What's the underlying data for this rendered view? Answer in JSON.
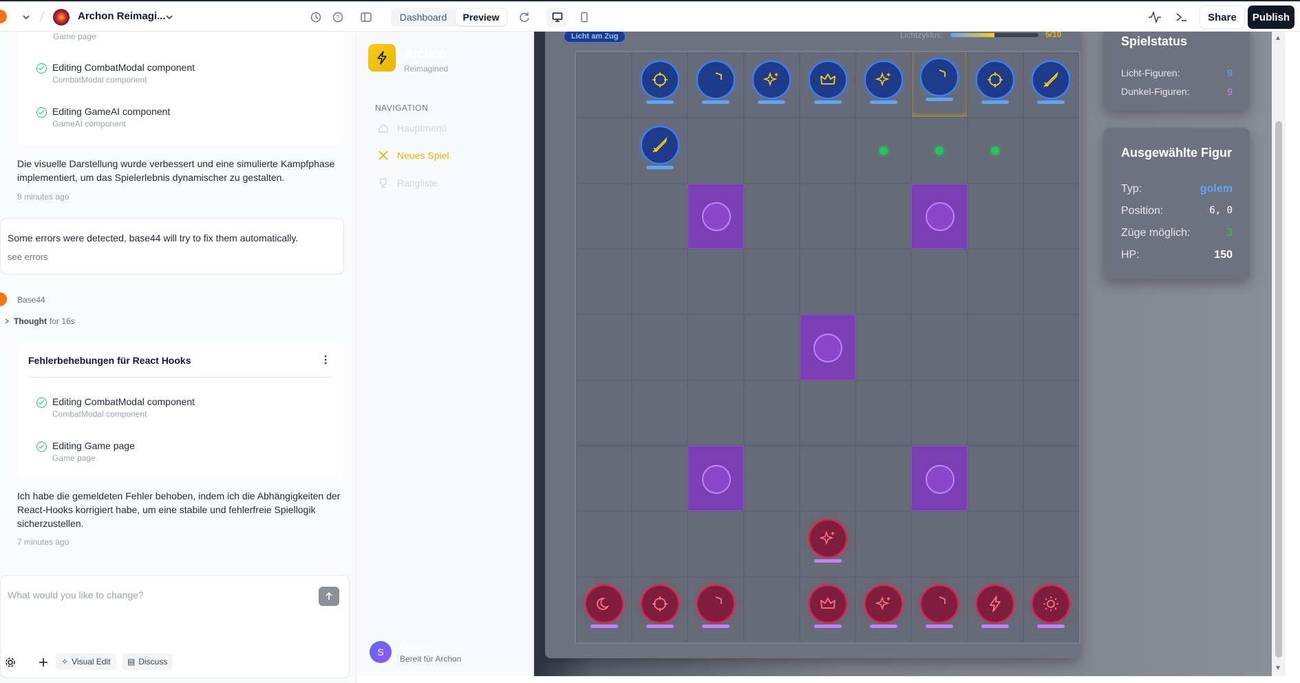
{
  "topbar": {
    "project_name": "Archon Reimagi...",
    "tabs": [
      "Dashboard",
      "Preview"
    ],
    "share": "Share",
    "publish": "Publish"
  },
  "chat": {
    "card1": {
      "prev_sub": "Game page",
      "tasks": [
        {
          "title": "Editing CombatModal component",
          "sub": "CombatModal component"
        },
        {
          "title": "Editing GameAI component",
          "sub": "GameAI component"
        }
      ]
    },
    "msg1": "Die visuelle Darstellung wurde verbessert und eine simulierte Kampfphase implementiert, um das Spielerlebnis dynamischer zu gestalten.",
    "msg1_time": "8 minutes ago",
    "error_text": "Some errors were detected, base44 will try to fix them automatically.",
    "error_link": "see errors",
    "agent_name": "Base44",
    "thought": "Thought",
    "thought_time": "for 16s",
    "card2": {
      "title": "Fehlerbehebungen für React Hooks",
      "tasks": [
        {
          "title": "Editing CombatModal component",
          "sub": "CombatModal component"
        },
        {
          "title": "Editing Game page",
          "sub": "Game page"
        }
      ]
    },
    "msg2": "Ich habe die gemeldeten Fehler behoben, indem ich die Abhängigkeiten der React-Hooks korrigiert habe, um eine stabile und fehlerfreie Spiellogik sicherzustellen.",
    "msg2_time": "7 minutes ago",
    "input_placeholder": "What would you like to change?",
    "visual_edit": "Visual Edit",
    "discuss": "Discuss"
  },
  "app": {
    "brand": "Archon",
    "brand_sub": "Reimagined",
    "nav_heading": "NAVIGATION",
    "nav_items": [
      "Hauptmenü",
      "Neues Spiel",
      "Rangliste"
    ],
    "user_initial": "S",
    "user_name": "Spieler",
    "user_status": "Bereit für Archon"
  },
  "game": {
    "turn_badge": "Licht am Zug",
    "cycle_label": "Lichtzyklus:",
    "cycle_value": "5/10",
    "cycle_fraction": 0.5,
    "status": {
      "title": "Spielstatus",
      "light_label": "Licht-Figuren:",
      "light_value": "9",
      "dark_label": "Dunkel-Figuren:",
      "dark_value": "9"
    },
    "selected": {
      "title": "Ausgewählte Figur",
      "type_label": "Typ:",
      "type_value": "golem",
      "pos_label": "Position:",
      "pos_value": "6, 0",
      "moves_label": "Züge möglich:",
      "moves_value": "3",
      "hp_label": "HP:",
      "hp_value": "150"
    },
    "colors": {
      "light": "#3b82f6",
      "dark": "#e11d48",
      "gold": "#eab308",
      "purple": "#7a3fb3"
    }
  }
}
